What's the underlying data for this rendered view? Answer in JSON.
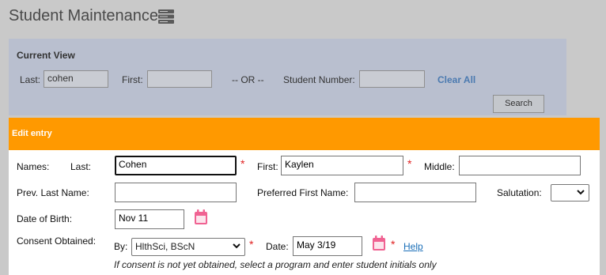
{
  "page": {
    "title": "Student Maintenance",
    "menu_icon": "server-stack-icon"
  },
  "current_view": {
    "heading": "Current View",
    "last_label": "Last:",
    "last_value": "cohen",
    "first_label": "First:",
    "first_value": "",
    "or_text": "-- OR --",
    "student_number_label": "Student Number:",
    "student_number_value": "",
    "clear_all": "Clear All",
    "search": "Search"
  },
  "edit_entry": {
    "header": "Edit entry",
    "names_label": "Names:",
    "last_label": "Last:",
    "last_value": "Cohen",
    "first_label": "First:",
    "first_value": "Kaylen",
    "middle_label": "Middle:",
    "middle_value": "",
    "prev_last_label": "Prev. Last Name:",
    "prev_last_value": "",
    "preferred_first_label": "Preferred First Name:",
    "preferred_first_value": "",
    "salutation_label": "Salutation:",
    "salutation_value": "",
    "dob_label": "Date of Birth:",
    "dob_value": "Nov 11",
    "consent_label": "Consent Obtained:",
    "by_label": "By:",
    "by_value": "HlthSci, BScN",
    "date_label": "Date:",
    "date_value": "May 3/19",
    "help": "Help",
    "consent_note": "If consent is not yet obtained, select a program and enter student initials only",
    "required_mark": "*"
  },
  "colors": {
    "page_bg": "#c9c9c9",
    "current_view_bg": "#b9bfcf",
    "edit_header_bg": "#ff9900",
    "link": "#4b7ab0",
    "required": "#e02020",
    "calendar_icon": "#f06292"
  }
}
